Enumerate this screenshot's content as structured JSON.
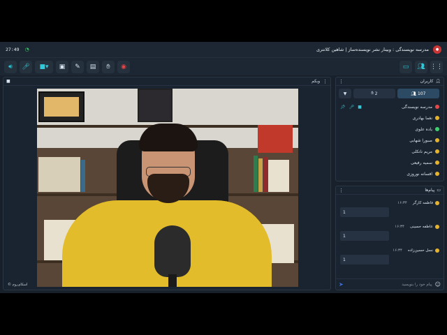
{
  "status": {
    "time": "27:49"
  },
  "app": {
    "title": "مدرسه نویسندگی : وبینار نشر نویسنده‌ساز | شاهین کلانتری"
  },
  "webcam": {
    "title": "وبکم",
    "brand": "اسکای‌روم ©"
  },
  "users": {
    "title": "کاربران",
    "count": "107",
    "hands": "2",
    "list": [
      {
        "name": "مدرسه نویسندگی",
        "color": "#e24a4a"
      },
      {
        "name": "نغما بهادری",
        "color": "#e5b330"
      },
      {
        "name": "یاده علوی",
        "color": "#3ecf6e"
      },
      {
        "name": "صبورا شهابی",
        "color": "#e5b330"
      },
      {
        "name": "مریم نانکلی",
        "color": "#e5b330"
      },
      {
        "name": "سمیه رفیعی",
        "color": "#e5b330"
      },
      {
        "name": "افسانه نوروزی",
        "color": "#e5b330"
      }
    ]
  },
  "chat": {
    "title": "پیام‌ها",
    "messages": [
      {
        "name": "فاطمه کارگر",
        "time": "۱۶:۳۴",
        "text": "1"
      },
      {
        "name": "عاطفه حسینی",
        "time": "۱۶:۳۴",
        "text": "1"
      },
      {
        "name": "نسل حسین‌زاده",
        "time": "۱۶:۳۴",
        "text": "1"
      }
    ],
    "placeholder": "پیام خود را بنویسید"
  }
}
